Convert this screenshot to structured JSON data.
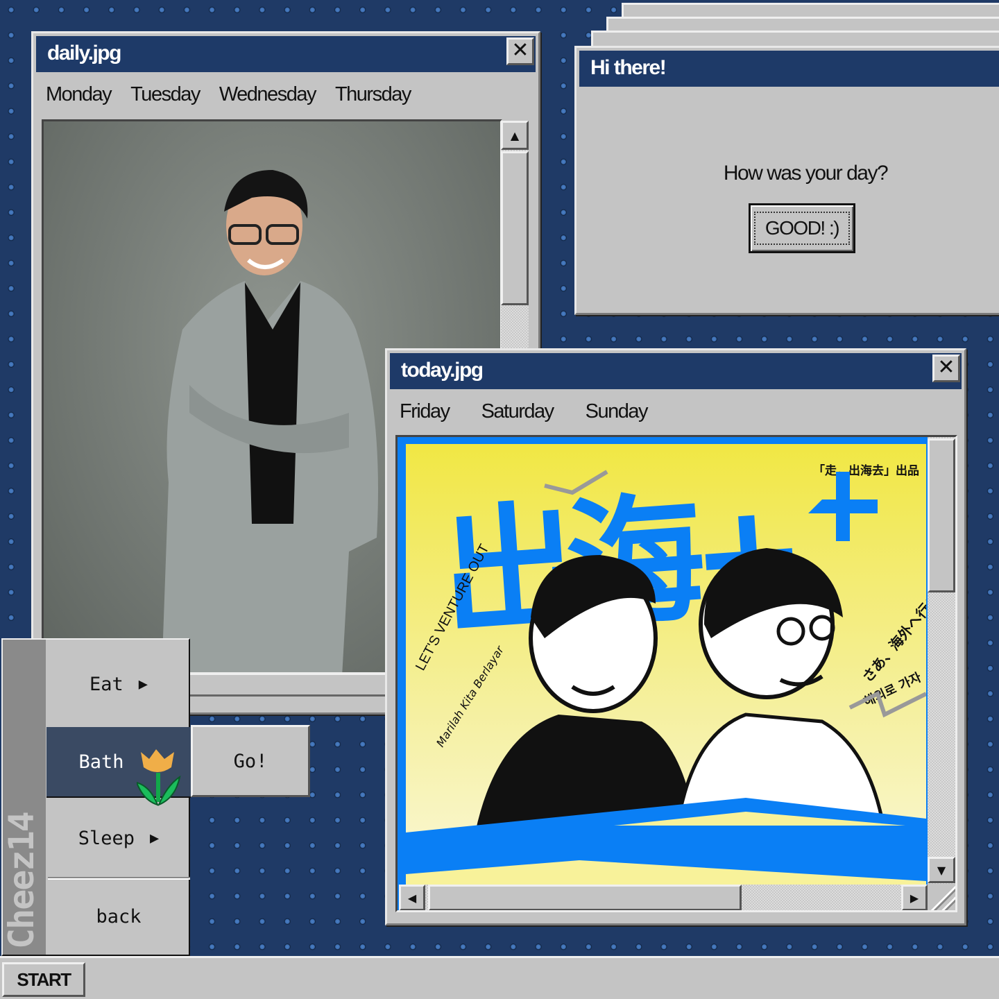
{
  "daily_window": {
    "title": "daily.jpg",
    "close": "✕",
    "menu": [
      "Monday",
      "Tuesday",
      "Wednesday",
      "Thursday"
    ]
  },
  "dialog": {
    "title": "Hi there!",
    "message": "How was your day?",
    "button": "GOOD! :)"
  },
  "today_window": {
    "title": "today.jpg",
    "close": "✕",
    "menu": [
      "Friday",
      "Saturday",
      "Sunday"
    ],
    "poster": {
      "headline": "出海+",
      "credit": "「走，出海去」出品",
      "english": "LET'S VENTURE OUT",
      "malay": "Marilah Kita Berlayar",
      "japanese": "さあ、海外へ行こう",
      "korean": "해외로 가자"
    }
  },
  "start_menu": {
    "brand": "Cheez14",
    "items": [
      {
        "label": "Eat",
        "submenu": true
      },
      {
        "label": "Bath",
        "submenu": false,
        "selected": true
      },
      {
        "label": "Sleep",
        "submenu": true
      },
      {
        "label": "back",
        "submenu": false
      }
    ],
    "arrow": "▶"
  },
  "go_button": "Go!",
  "taskbar": {
    "start": "START"
  },
  "colors": {
    "desktop": "#1f3a66",
    "titlebar": "#1e3a68",
    "chrome": "#c4c4c4",
    "highlight": "#3a4a63",
    "poster_blue": "#0a7ff5",
    "poster_yellow": "#f2e84a"
  }
}
